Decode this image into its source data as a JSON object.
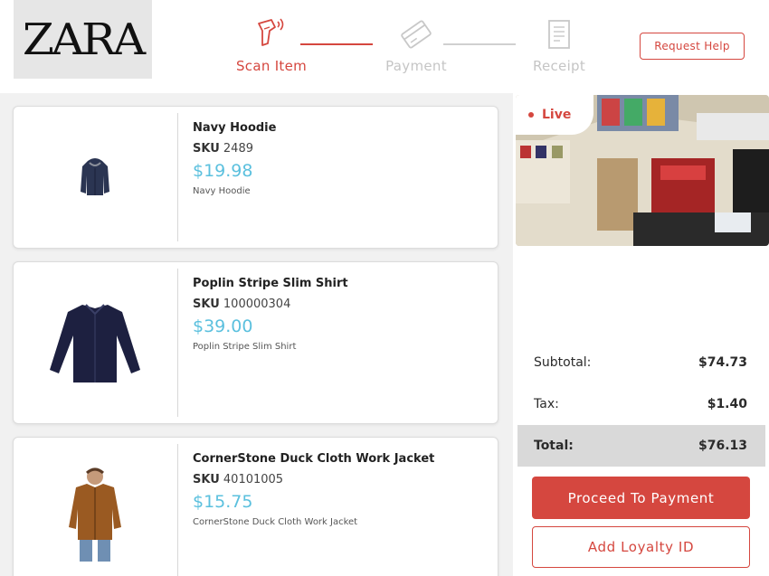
{
  "brand": {
    "logo_text": "ZARA"
  },
  "steps": [
    {
      "label": "Scan Item",
      "state": "active",
      "icon": "barcode-scanner-icon"
    },
    {
      "label": "Payment",
      "state": "inactive",
      "icon": "credit-card-icon"
    },
    {
      "label": "Receipt",
      "state": "inactive",
      "icon": "receipt-icon"
    }
  ],
  "header": {
    "help_label": "Request Help"
  },
  "items": [
    {
      "name": "Navy Hoodie",
      "sku_label": "SKU",
      "sku": "2489",
      "price": "$19.98",
      "description": "Navy Hoodie",
      "icon": "hoodie-image"
    },
    {
      "name": "Poplin Stripe Slim Shirt",
      "sku_label": "SKU",
      "sku": "100000304",
      "price": "$39.00",
      "description": "Poplin Stripe Slim Shirt",
      "icon": "shirt-image"
    },
    {
      "name": "CornerStone Duck Cloth Work Jacket",
      "sku_label": "SKU",
      "sku": "40101005",
      "price": "$15.75",
      "description": "CornerStone Duck Cloth Work Jacket",
      "icon": "jacket-image"
    }
  ],
  "camera": {
    "live_label": "Live"
  },
  "totals": {
    "subtotal_label": "Subtotal:",
    "subtotal_value": "$74.73",
    "tax_label": "Tax:",
    "tax_value": "$1.40",
    "total_label": "Total:",
    "total_value": "$76.13"
  },
  "actions": {
    "proceed_label": "Proceed To Payment",
    "loyalty_label": "Add Loyalty ID"
  },
  "colors": {
    "accent": "#d5473f",
    "price": "#5bc0de",
    "panel_bg": "#f1f1f1"
  }
}
